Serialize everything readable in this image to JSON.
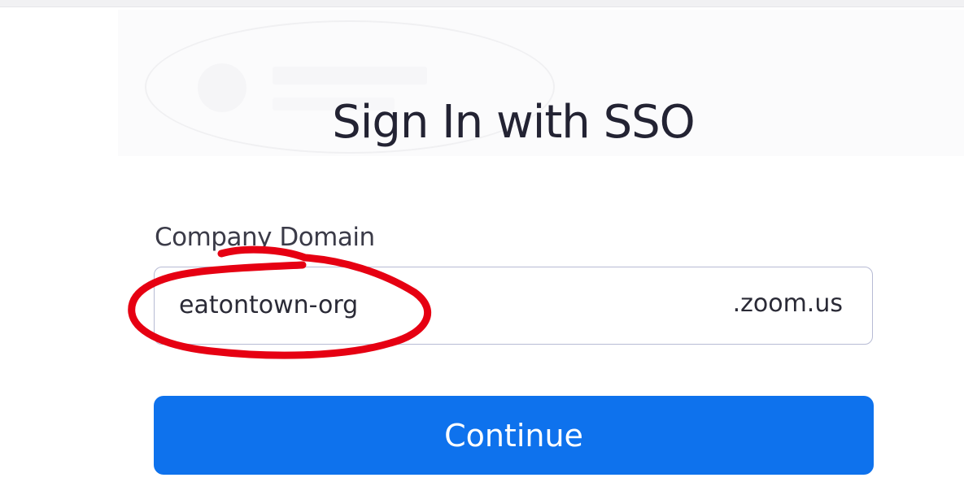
{
  "title": "Sign In with SSO",
  "company_domain": {
    "label": "Company Domain",
    "value": "eatontown-org",
    "suffix": ".zoom.us"
  },
  "continue_button": {
    "label": "Continue"
  },
  "colors": {
    "primary_button": "#0e72ed",
    "annotation": "#e60012",
    "field_border": "#b7bbd4",
    "title_text": "#232333"
  }
}
